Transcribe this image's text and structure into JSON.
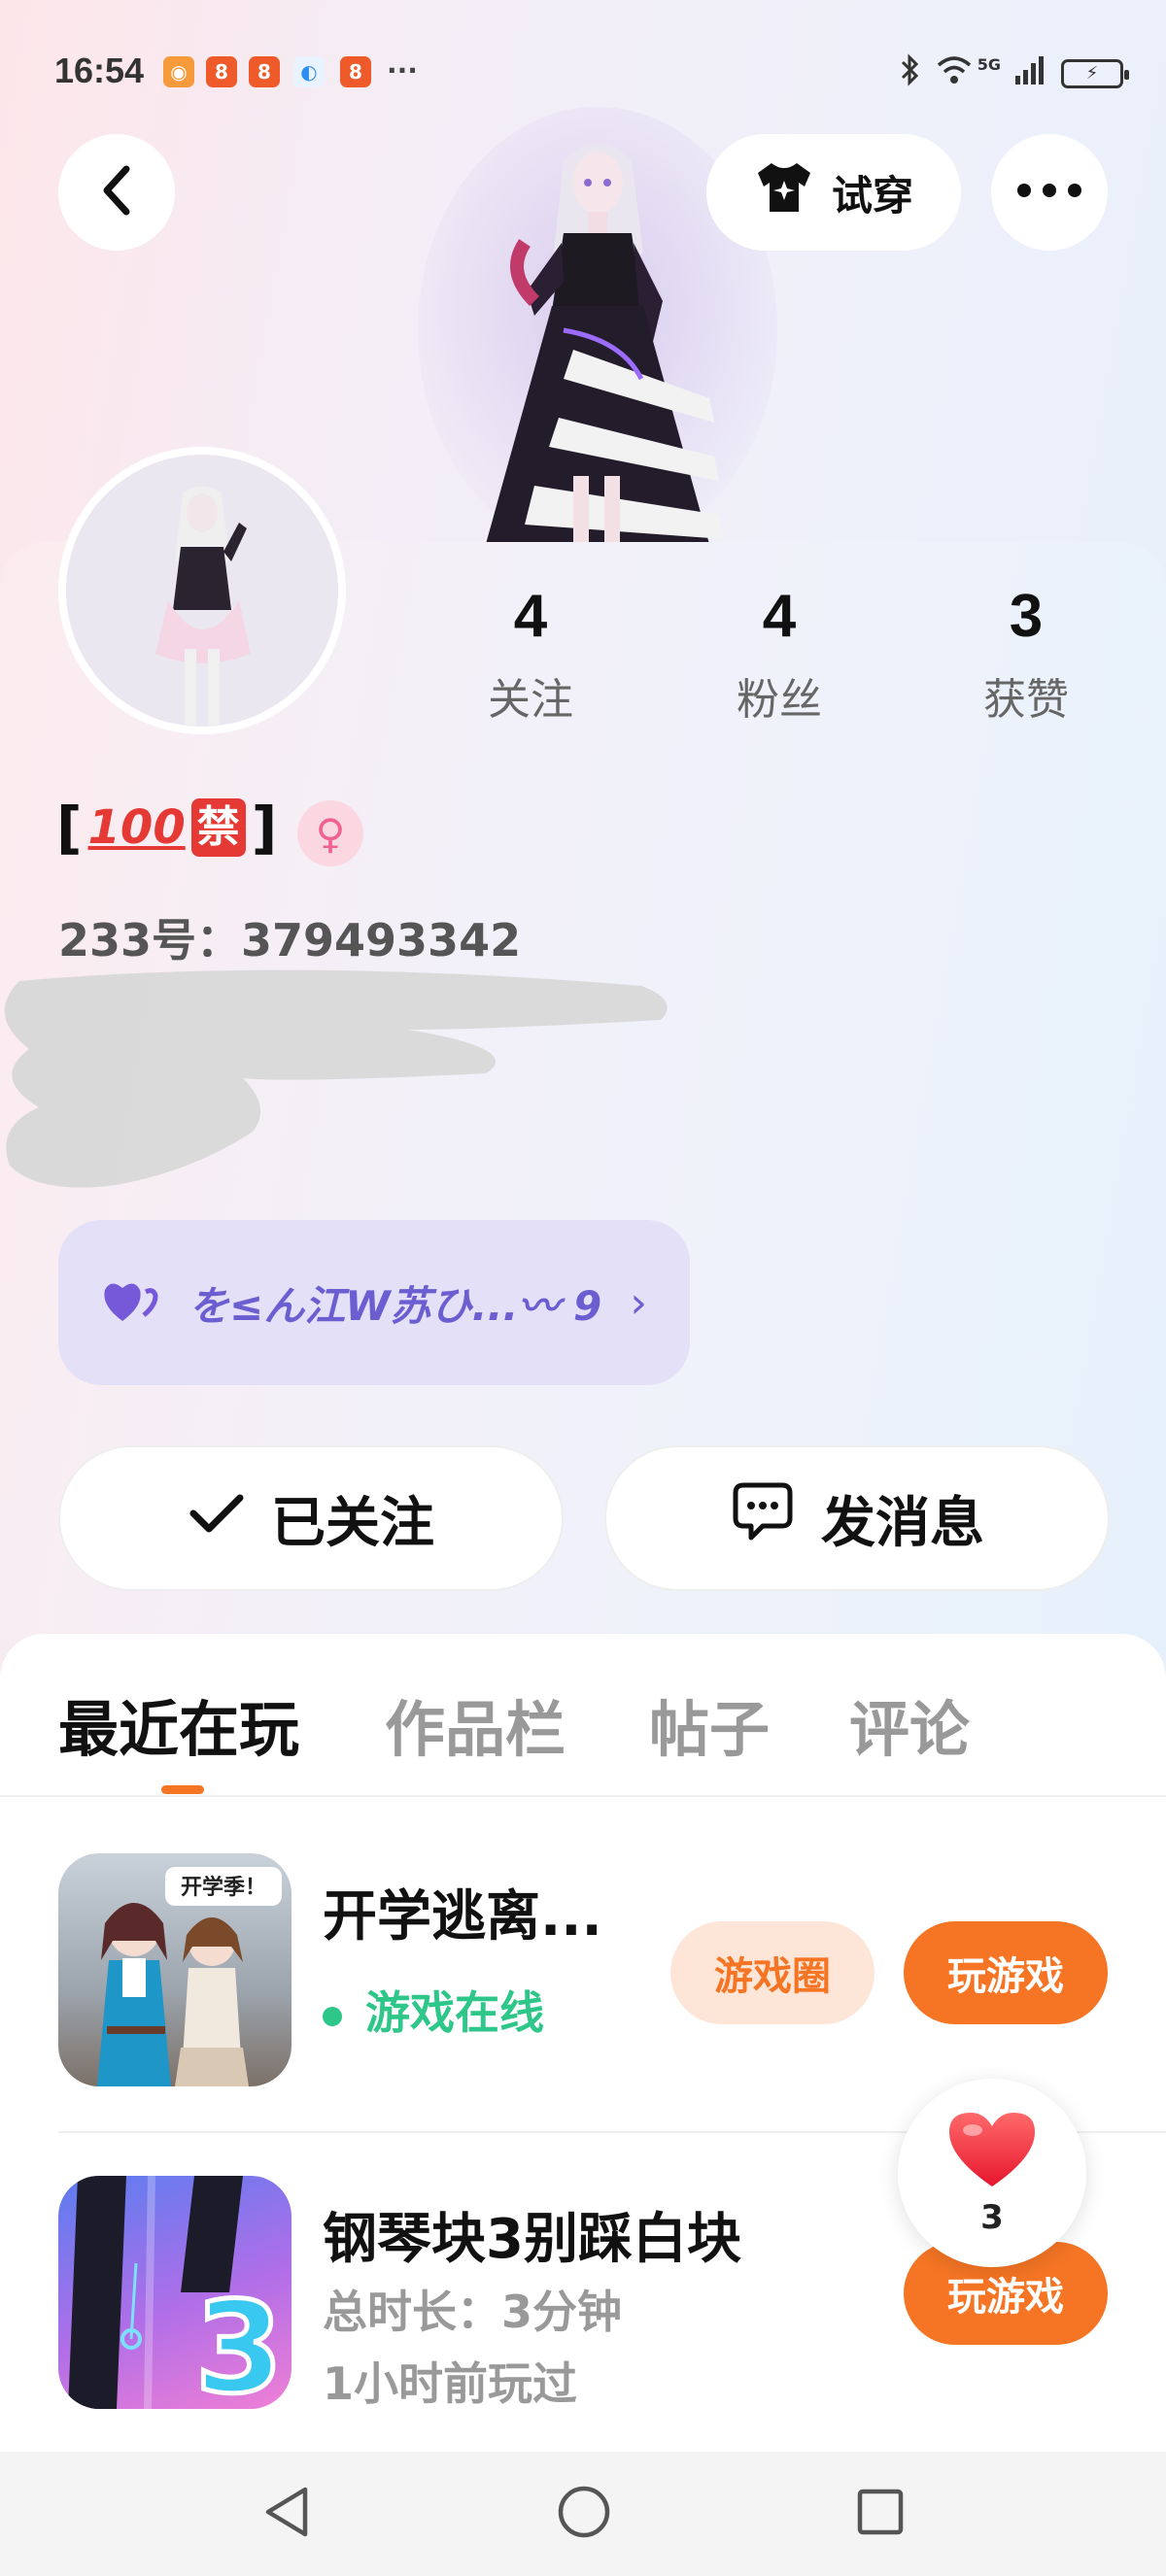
{
  "status_bar": {
    "time": "16:54",
    "notification_icons": [
      "shopping-icon",
      "app-icon",
      "app-icon",
      "weather-icon",
      "app-icon"
    ],
    "more": "···",
    "network": "5G",
    "icons": [
      "bluetooth-icon",
      "wifi-icon",
      "signal-icon",
      "battery-charging-icon"
    ]
  },
  "top_bar": {
    "try_on_label": "试穿"
  },
  "profile": {
    "stats": [
      {
        "value": "4",
        "label": "关注"
      },
      {
        "value": "4",
        "label": "粉丝"
      },
      {
        "value": "3",
        "label": "获赞"
      }
    ],
    "username_open": "[",
    "username_emoji_1": "100",
    "username_emoji_2": "禁",
    "username_close": "]",
    "gender_symbol": "♀",
    "uid": "233号：379493342",
    "signature": "を≤ん江W苏ひ...〰 9",
    "signature_chevron": "›"
  },
  "actions": {
    "followed_label": "已关注",
    "message_label": "发消息"
  },
  "tabs": [
    {
      "label": "最近在玩",
      "active": true
    },
    {
      "label": "作品栏",
      "active": false
    },
    {
      "label": "帖子",
      "active": false
    },
    {
      "label": "评论",
      "active": false
    }
  ],
  "games": [
    {
      "title": "开学逃离...",
      "status": "游戏在线",
      "circle_label": "游戏圈",
      "play_label": "玩游戏",
      "icon_badge": "开学季！"
    },
    {
      "title": "钢琴块3别踩白块",
      "duration": "总时长：3分钟",
      "last_played": "1小时前玩过",
      "play_label": "玩游戏",
      "icon_number": "3"
    }
  ],
  "like_float": {
    "count": "3"
  },
  "colors": {
    "accent": "#f57524",
    "online": "#2fc68a",
    "signature_bg": "#e4e0f7"
  }
}
